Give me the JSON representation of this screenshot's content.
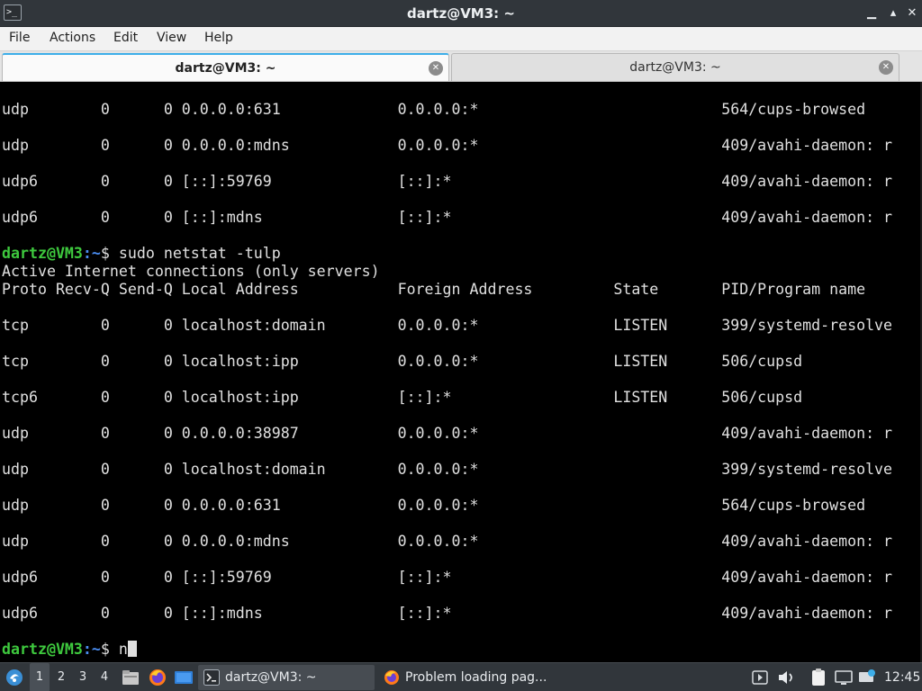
{
  "window": {
    "title": "dartz@VM3: ~",
    "app_icon": "terminal-icon",
    "controls": {
      "minimize": "▁",
      "maximize": "▴",
      "close": "✕"
    }
  },
  "menu": [
    "File",
    "Actions",
    "Edit",
    "View",
    "Help"
  ],
  "tabs": [
    {
      "label": "dartz@VM3: ~",
      "active": true
    },
    {
      "label": "dartz@VM3: ~",
      "active": false
    }
  ],
  "terminal": {
    "prompt_user": "dartz@VM3",
    "prompt_path": ":~",
    "lines": [
      {
        "type": "text",
        "text": "udp        0      0 0.0.0.0:631             0.0.0.0:*                           564/cups-browsed"
      },
      {
        "type": "text",
        "text": "udp        0      0 0.0.0.0:mdns            0.0.0.0:*                           409/avahi-daemon: r"
      },
      {
        "type": "text",
        "text": "udp6       0      0 [::]:59769              [::]:*                              409/avahi-daemon: r"
      },
      {
        "type": "text",
        "text": "udp6       0      0 [::]:mdns               [::]:*                              409/avahi-daemon: r"
      },
      {
        "type": "prompt",
        "text": "$ sudo netstat -tulp"
      },
      {
        "type": "text",
        "text": "Active Internet connections (only servers)"
      },
      {
        "type": "text",
        "text": "Proto Recv-Q Send-Q Local Address           Foreign Address         State       PID/Program name"
      },
      {
        "type": "text",
        "text": "tcp        0      0 localhost:domain        0.0.0.0:*               LISTEN      399/systemd-resolve"
      },
      {
        "type": "text",
        "text": "tcp        0      0 localhost:ipp           0.0.0.0:*               LISTEN      506/cupsd"
      },
      {
        "type": "text",
        "text": "tcp6       0      0 localhost:ipp           [::]:*                  LISTEN      506/cupsd"
      },
      {
        "type": "text",
        "text": "udp        0      0 0.0.0.0:38987           0.0.0.0:*                           409/avahi-daemon: r"
      },
      {
        "type": "text",
        "text": "udp        0      0 localhost:domain        0.0.0.0:*                           399/systemd-resolve"
      },
      {
        "type": "text",
        "text": "udp        0      0 0.0.0.0:631             0.0.0.0:*                           564/cups-browsed"
      },
      {
        "type": "text",
        "text": "udp        0      0 0.0.0.0:mdns            0.0.0.0:*                           409/avahi-daemon: r"
      },
      {
        "type": "text",
        "text": "udp6       0      0 [::]:59769              [::]:*                              409/avahi-daemon: r"
      },
      {
        "type": "text",
        "text": "udp6       0      0 [::]:mdns               [::]:*                              409/avahi-daemon: r"
      },
      {
        "type": "input",
        "text": "$ n"
      }
    ]
  },
  "taskbar": {
    "start_icon": "start-menu-icon",
    "workspaces": [
      "1",
      "2",
      "3",
      "4"
    ],
    "active_workspace": "1",
    "launchers": [
      "file-manager-icon",
      "firefox-icon",
      "desktop-icon"
    ],
    "tasks": [
      {
        "label": "dartz@VM3: ~",
        "icon": "terminal-icon",
        "active": true
      },
      {
        "label": "Problem loading pag...",
        "icon": "firefox-icon",
        "active": false
      }
    ],
    "tray_icons": [
      "media-icon",
      "volume-icon",
      "clipboard-icon",
      "display-icon",
      "network-icon"
    ],
    "clock": "12:45"
  }
}
